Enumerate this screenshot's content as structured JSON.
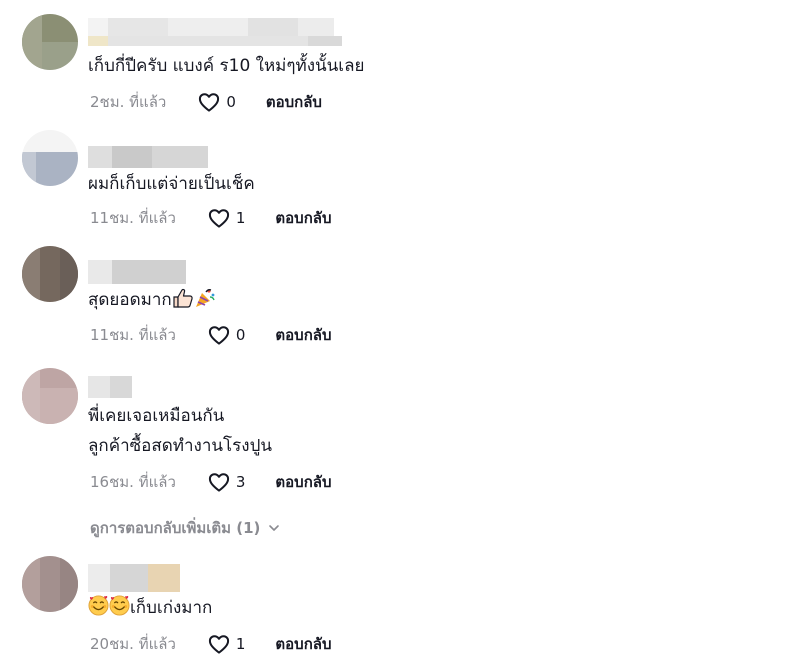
{
  "comments": [
    {
      "text": "เก็บกี่ปีครับ แบงค์ ร10 ใหม่ๆทั้งนั้นเลย",
      "time": "2ชม. ที่แล้ว",
      "likes": "0",
      "reply": "ตอบกลับ"
    },
    {
      "text": "ผมก็เก็บแต่จ่ายเป็นเช็ค",
      "time": "11ชม. ที่แล้ว",
      "likes": "1",
      "reply": "ตอบกลับ"
    },
    {
      "text": "สุดยอดมาก",
      "time": "11ชม. ที่แล้ว",
      "likes": "0",
      "reply": "ตอบกลับ"
    },
    {
      "text_line1": "พี่เคยเจอเหมือนกัน",
      "text_line2": "ลูกค้าซื้อสดทำงานโรงปูน",
      "time": "16ชม. ที่แล้ว",
      "likes": "3",
      "reply": "ตอบกลับ"
    },
    {
      "text": "เก็บเก่งมาก",
      "time": "20ชม. ที่แล้ว",
      "likes": "1",
      "reply": "ตอบกลับ"
    }
  ],
  "view_more_replies": "ดูการตอบกลับเพิ่มเติม (1)",
  "icons": {
    "like": "heart-outline-icon",
    "expand": "chevron-down-icon"
  }
}
